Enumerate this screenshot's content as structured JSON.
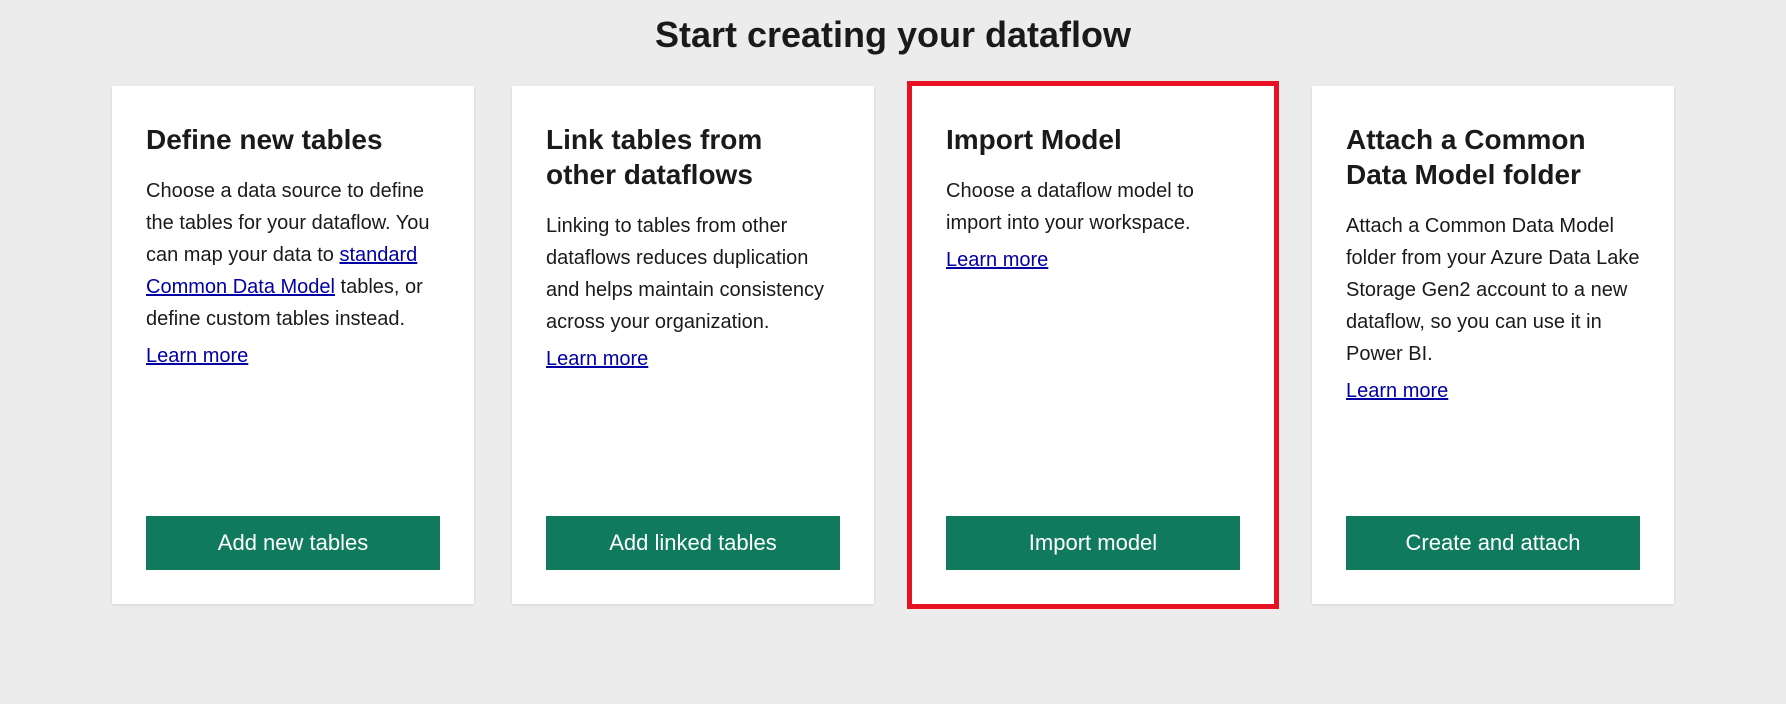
{
  "page_title": "Start creating your dataflow",
  "cards": [
    {
      "title": "Define new tables",
      "description_pre": "Choose a data source to define the tables for your dataflow. You can map your data to ",
      "description_link": "standard Common Data Model",
      "description_post": " tables, or define custom tables instead.",
      "learn_more": "Learn more",
      "button": "Add new tables"
    },
    {
      "title": "Link tables from other dataflows",
      "description": "Linking to tables from other dataflows reduces duplication and helps maintain consistency across your organization.",
      "learn_more": "Learn more",
      "button": "Add linked tables"
    },
    {
      "title": "Import Model",
      "description": "Choose a dataflow model to import into your workspace.",
      "learn_more": "Learn more",
      "button": "Import model"
    },
    {
      "title": "Attach a Common Data Model folder",
      "description": "Attach a Common Data Model folder from your Azure Data Lake Storage Gen2 account to a new dataflow, so you can use it in Power BI.",
      "learn_more": "Learn more",
      "button": "Create and attach"
    }
  ]
}
